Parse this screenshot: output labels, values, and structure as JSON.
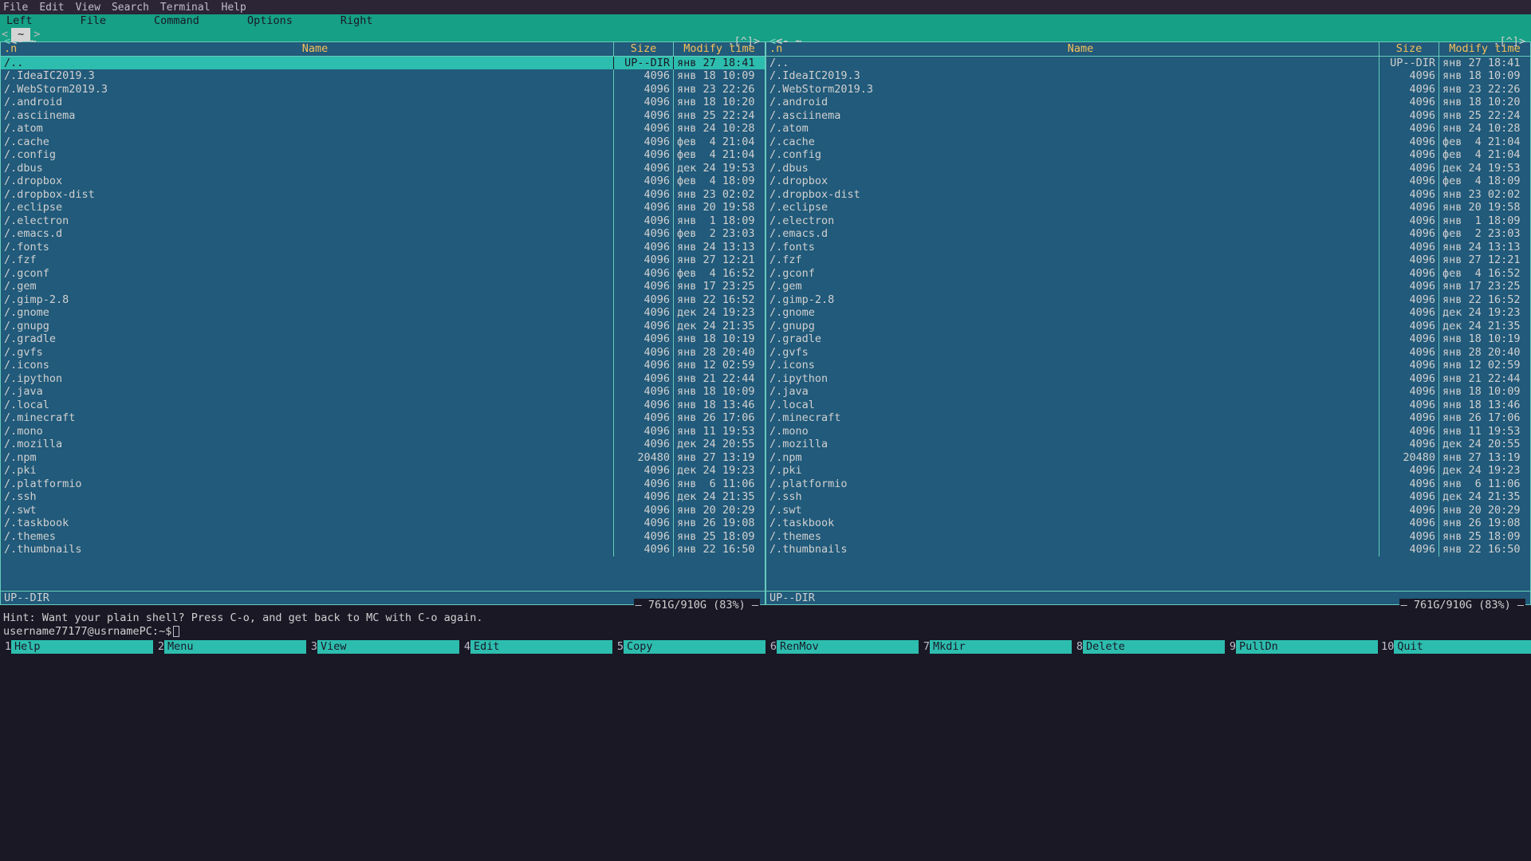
{
  "window_menu": [
    "File",
    "Edit",
    "View",
    "Search",
    "Terminal",
    "Help"
  ],
  "mc_menu": [
    "Left",
    "File",
    "Command",
    "Options",
    "Right"
  ],
  "tab": {
    "label": "~"
  },
  "columns": {
    "n": ".n",
    "name": "Name",
    "size": "Size",
    "mtime": "Modify time"
  },
  "path_display": "<- ~",
  "caret": ".[^]>",
  "status_text": "UP--DIR",
  "disk_usage": "761G/910G (83%)",
  "hint": "Hint: Want your plain shell? Press C-o, and get back to MC with C-o again.",
  "prompt": "username77177@usrnamePC:~$",
  "fkeys": [
    {
      "n": "1",
      "label": "Help"
    },
    {
      "n": "2",
      "label": "Menu"
    },
    {
      "n": "3",
      "label": "View"
    },
    {
      "n": "4",
      "label": "Edit"
    },
    {
      "n": "5",
      "label": "Copy"
    },
    {
      "n": "6",
      "label": "RenMov"
    },
    {
      "n": "7",
      "label": "Mkdir"
    },
    {
      "n": "8",
      "label": "Delete"
    },
    {
      "n": "9",
      "label": "PullDn"
    },
    {
      "n": "10",
      "label": "Quit"
    }
  ],
  "files": [
    {
      "name": "/..",
      "size": "UP--DIR",
      "mtime": "янв 27 18:41",
      "selected": true
    },
    {
      "name": "/.IdeaIC2019.3",
      "size": "4096",
      "mtime": "янв 18 10:09"
    },
    {
      "name": "/.WebStorm2019.3",
      "size": "4096",
      "mtime": "янв 23 22:26"
    },
    {
      "name": "/.android",
      "size": "4096",
      "mtime": "янв 18 10:20"
    },
    {
      "name": "/.asciinema",
      "size": "4096",
      "mtime": "янв 25 22:24"
    },
    {
      "name": "/.atom",
      "size": "4096",
      "mtime": "янв 24 10:28"
    },
    {
      "name": "/.cache",
      "size": "4096",
      "mtime": "фев  4 21:04"
    },
    {
      "name": "/.config",
      "size": "4096",
      "mtime": "фев  4 21:04"
    },
    {
      "name": "/.dbus",
      "size": "4096",
      "mtime": "дек 24 19:53"
    },
    {
      "name": "/.dropbox",
      "size": "4096",
      "mtime": "фев  4 18:09"
    },
    {
      "name": "/.dropbox-dist",
      "size": "4096",
      "mtime": "янв 23 02:02"
    },
    {
      "name": "/.eclipse",
      "size": "4096",
      "mtime": "янв 20 19:58"
    },
    {
      "name": "/.electron",
      "size": "4096",
      "mtime": "янв  1 18:09"
    },
    {
      "name": "/.emacs.d",
      "size": "4096",
      "mtime": "фев  2 23:03"
    },
    {
      "name": "/.fonts",
      "size": "4096",
      "mtime": "янв 24 13:13"
    },
    {
      "name": "/.fzf",
      "size": "4096",
      "mtime": "янв 27 12:21"
    },
    {
      "name": "/.gconf",
      "size": "4096",
      "mtime": "фев  4 16:52"
    },
    {
      "name": "/.gem",
      "size": "4096",
      "mtime": "янв 17 23:25"
    },
    {
      "name": "/.gimp-2.8",
      "size": "4096",
      "mtime": "янв 22 16:52"
    },
    {
      "name": "/.gnome",
      "size": "4096",
      "mtime": "дек 24 19:23"
    },
    {
      "name": "/.gnupg",
      "size": "4096",
      "mtime": "дек 24 21:35"
    },
    {
      "name": "/.gradle",
      "size": "4096",
      "mtime": "янв 18 10:19"
    },
    {
      "name": "/.gvfs",
      "size": "4096",
      "mtime": "янв 28 20:40"
    },
    {
      "name": "/.icons",
      "size": "4096",
      "mtime": "янв 12 02:59"
    },
    {
      "name": "/.ipython",
      "size": "4096",
      "mtime": "янв 21 22:44"
    },
    {
      "name": "/.java",
      "size": "4096",
      "mtime": "янв 18 10:09"
    },
    {
      "name": "/.local",
      "size": "4096",
      "mtime": "янв 18 13:46"
    },
    {
      "name": "/.minecraft",
      "size": "4096",
      "mtime": "янв 26 17:06"
    },
    {
      "name": "/.mono",
      "size": "4096",
      "mtime": "янв 11 19:53"
    },
    {
      "name": "/.mozilla",
      "size": "4096",
      "mtime": "дек 24 20:55"
    },
    {
      "name": "/.npm",
      "size": "20480",
      "mtime": "янв 27 13:19"
    },
    {
      "name": "/.pki",
      "size": "4096",
      "mtime": "дек 24 19:23"
    },
    {
      "name": "/.platformio",
      "size": "4096",
      "mtime": "янв  6 11:06"
    },
    {
      "name": "/.ssh",
      "size": "4096",
      "mtime": "дек 24 21:35"
    },
    {
      "name": "/.swt",
      "size": "4096",
      "mtime": "янв 20 20:29"
    },
    {
      "name": "/.taskbook",
      "size": "4096",
      "mtime": "янв 26 19:08"
    },
    {
      "name": "/.themes",
      "size": "4096",
      "mtime": "янв 25 18:09"
    },
    {
      "name": "/.thumbnails",
      "size": "4096",
      "mtime": "янв 22 16:50"
    }
  ]
}
